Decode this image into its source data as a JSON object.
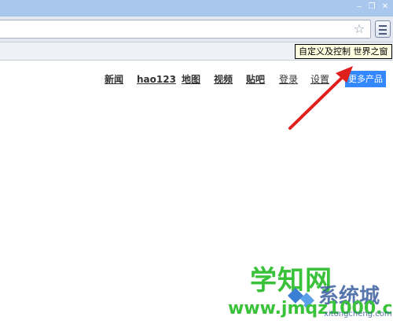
{
  "window": {
    "minimize_glyph": "‒",
    "restore_glyph": "❐",
    "close_glyph": "✕"
  },
  "toolbar": {
    "address_value": "",
    "star_icon": "star-icon",
    "menu_icon": "hamburger-menu-icon"
  },
  "tooltip": {
    "text": "自定义及控制 世界之窗"
  },
  "nav": {
    "items": [
      {
        "label": "新闻"
      },
      {
        "label": "hao123"
      },
      {
        "label": "地图"
      },
      {
        "label": "视频"
      },
      {
        "label": "贴吧"
      },
      {
        "label": "登录"
      },
      {
        "label": "设置"
      }
    ],
    "more_button": "更多产品"
  },
  "annotation": {
    "arrow_color": "#e0201c"
  },
  "watermark": {
    "top_text": "学知网",
    "bottom_text": "www.jmqz1000.com",
    "system_text": "系统城",
    "domain_text": "xitongcheng.com"
  },
  "colors": {
    "titlebar": "#a9c6ed",
    "more_button": "#3388ff",
    "tooltip_bg": "#ffffe1",
    "watermark_green": "#39c13a",
    "watermark_blue": "#3a5f9e"
  }
}
